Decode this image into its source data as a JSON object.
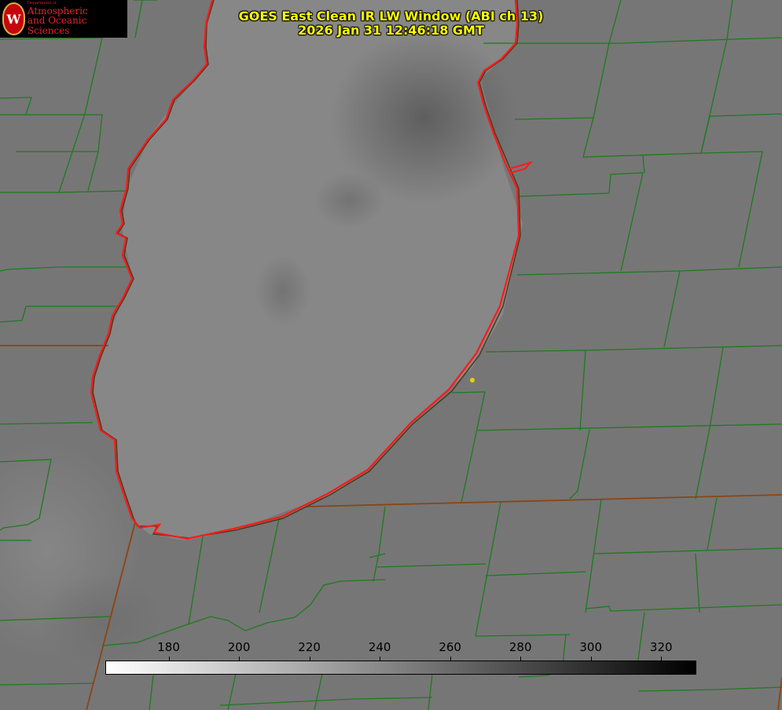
{
  "logo": {
    "department_label": "Department of",
    "line1": "Atmospheric",
    "line2": "and Oceanic Sciences",
    "seal_letter": "W"
  },
  "title": {
    "line1": "GOES East Clean IR LW Window (ABI ch 13)",
    "line2": "2026 Jan 31 12:46:18 GMT"
  },
  "colorbar": {
    "ticks": [
      "180",
      "200",
      "220",
      "240",
      "260",
      "280",
      "300",
      "320"
    ],
    "range": [
      162,
      330
    ],
    "colors": {
      "low": "#ffffff",
      "high": "#000000"
    }
  },
  "map": {
    "lake_fill": "#868686",
    "land_fill": "#777777",
    "county_line_color": "#1e7a1e",
    "shoreline_color": "#ff1a1a",
    "state_line_color": "#8b4513",
    "marker_color": "#e6d200"
  }
}
